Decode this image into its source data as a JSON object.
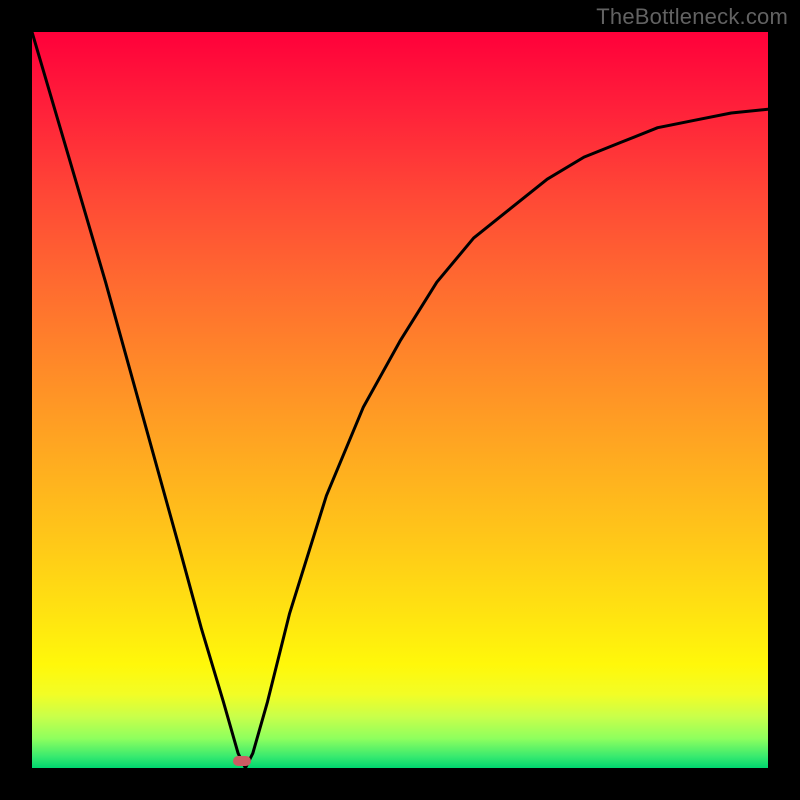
{
  "watermark": "TheBottleneck.com",
  "colors": {
    "frame_bg": "#000000",
    "gradient_top": "#ff003a",
    "gradient_bottom": "#00d66f",
    "curve": "#000000",
    "pill": "#cc5b63",
    "watermark_text": "#626262"
  },
  "chart_data": {
    "type": "line",
    "title": "",
    "xlabel": "",
    "ylabel": "",
    "xlim": [
      0,
      1
    ],
    "ylim": [
      0,
      1
    ],
    "legend": false,
    "grid": false,
    "annotations": [
      {
        "kind": "marker",
        "shape": "pill",
        "x": 0.285,
        "y": 0.0,
        "color": "#cc5b63"
      }
    ],
    "background": {
      "kind": "vertical-gradient",
      "stops": [
        {
          "pos": 0.0,
          "color": "#ff003a"
        },
        {
          "pos": 0.46,
          "color": "#ff8b28"
        },
        {
          "pos": 0.8,
          "color": "#ffe610"
        },
        {
          "pos": 0.93,
          "color": "#c9ff4a"
        },
        {
          "pos": 1.0,
          "color": "#00d66f"
        }
      ]
    },
    "series": [
      {
        "name": "bottleneck-curve",
        "x": [
          0.0,
          0.05,
          0.1,
          0.15,
          0.2,
          0.23,
          0.26,
          0.28,
          0.29,
          0.3,
          0.32,
          0.35,
          0.4,
          0.45,
          0.5,
          0.55,
          0.6,
          0.65,
          0.7,
          0.75,
          0.8,
          0.85,
          0.9,
          0.95,
          1.0
        ],
        "y": [
          1.0,
          0.83,
          0.66,
          0.48,
          0.3,
          0.19,
          0.09,
          0.02,
          0.0,
          0.02,
          0.09,
          0.21,
          0.37,
          0.49,
          0.58,
          0.66,
          0.72,
          0.76,
          0.8,
          0.83,
          0.85,
          0.87,
          0.88,
          0.89,
          0.895
        ]
      }
    ]
  }
}
